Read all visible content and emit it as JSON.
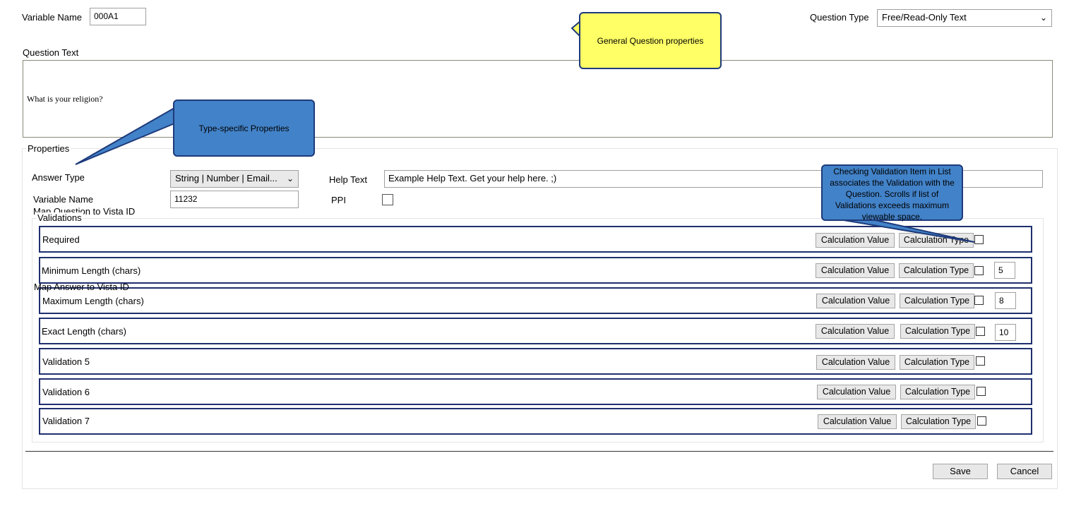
{
  "top": {
    "variable_name_label": "Variable Name",
    "variable_name_value": "000A1",
    "question_type_label": "Question Type",
    "question_type_value": "Free/Read-Only Text"
  },
  "question": {
    "label": "Question Text",
    "text": "What is your religion?"
  },
  "properties": {
    "legend": "Properties",
    "answer_type_label": "Answer Type",
    "answer_type_value": "String | Number | Email...",
    "help_text_label": "Help Text",
    "help_text_value": "Example Help Text.  Get your help here. ;)",
    "variable_name_label": "Variable Name",
    "variable_name_value": "11232",
    "ppi_label": "PPI",
    "map_question_label": "Map Question to Vista ID",
    "map_answer_label": "Map Answer to Vista ID"
  },
  "validations": {
    "legend": "Validations",
    "calc_value_label": "Calculation Value",
    "calc_type_label": "Calculation Type",
    "items": [
      {
        "label": "Required",
        "value": ""
      },
      {
        "label": "Minimum Length (chars)",
        "value": "5"
      },
      {
        "label": "Maximum Length (chars)",
        "value": "8"
      },
      {
        "label": "Exact Length (chars)",
        "value": "10"
      },
      {
        "label": "Validation 5",
        "value": ""
      },
      {
        "label": "Validation 6",
        "value": ""
      },
      {
        "label": "Validation 7",
        "value": ""
      }
    ]
  },
  "footer": {
    "save_label": "Save",
    "cancel_label": "Cancel"
  },
  "callouts": {
    "general": "General Question properties",
    "type_specific": "Type-specific Properties",
    "validation_note": "Checking Validation Item in List associates the Validation with the Question.  Scrolls if list of Validations exceeds maximum viewable space."
  },
  "colors": {
    "callout_blue": "#4282c8",
    "callout_yellow": "#ffff66",
    "validation_border": "#1f2f6e"
  }
}
